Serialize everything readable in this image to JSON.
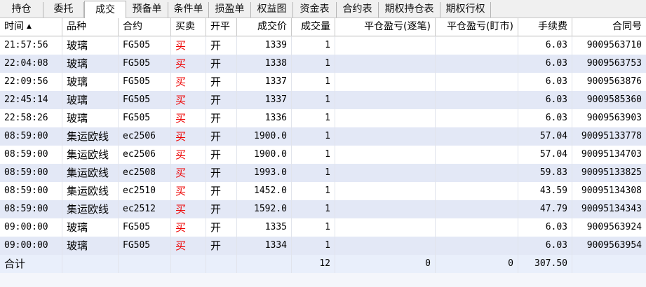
{
  "tabs": [
    {
      "label": "持仓",
      "active": false
    },
    {
      "label": "委托",
      "active": false
    },
    {
      "label": "成交",
      "active": true
    },
    {
      "label": "预备单",
      "active": false
    },
    {
      "label": "条件单",
      "active": false
    },
    {
      "label": "损盈单",
      "active": false
    },
    {
      "label": "权益图",
      "active": false
    },
    {
      "label": "资金表",
      "active": false
    },
    {
      "label": "合约表",
      "active": false
    },
    {
      "label": "期权持仓表",
      "active": false
    },
    {
      "label": "期权行权",
      "active": false
    }
  ],
  "table": {
    "columns": [
      "时间",
      "品种",
      "合约",
      "买卖",
      "开平",
      "成交价",
      "成交量",
      "平仓盈亏(逐笔)",
      "平仓盈亏(盯市)",
      "手续费",
      "合同号"
    ],
    "sort_icon": "sort-ascending-icon",
    "sort_glyph": "▲",
    "rows": [
      [
        "21:57:56",
        "玻璃",
        "FG505",
        "买",
        "开",
        "1339",
        "1",
        "",
        "",
        "6.03",
        "9009563710"
      ],
      [
        "22:04:08",
        "玻璃",
        "FG505",
        "买",
        "开",
        "1338",
        "1",
        "",
        "",
        "6.03",
        "9009563753"
      ],
      [
        "22:09:56",
        "玻璃",
        "FG505",
        "买",
        "开",
        "1337",
        "1",
        "",
        "",
        "6.03",
        "9009563876"
      ],
      [
        "22:45:14",
        "玻璃",
        "FG505",
        "买",
        "开",
        "1337",
        "1",
        "",
        "",
        "6.03",
        "9009585360"
      ],
      [
        "22:58:26",
        "玻璃",
        "FG505",
        "买",
        "开",
        "1336",
        "1",
        "",
        "",
        "6.03",
        "9009563903"
      ],
      [
        "08:59:00",
        "集运欧线",
        "ec2506",
        "买",
        "开",
        "1900.0",
        "1",
        "",
        "",
        "57.04",
        "90095133778"
      ],
      [
        "08:59:00",
        "集运欧线",
        "ec2506",
        "买",
        "开",
        "1900.0",
        "1",
        "",
        "",
        "57.04",
        "90095134703"
      ],
      [
        "08:59:00",
        "集运欧线",
        "ec2508",
        "买",
        "开",
        "1993.0",
        "1",
        "",
        "",
        "59.83",
        "90095133825"
      ],
      [
        "08:59:00",
        "集运欧线",
        "ec2510",
        "买",
        "开",
        "1452.0",
        "1",
        "",
        "",
        "43.59",
        "90095134308"
      ],
      [
        "08:59:00",
        "集运欧线",
        "ec2512",
        "买",
        "开",
        "1592.0",
        "1",
        "",
        "",
        "47.79",
        "90095134343"
      ],
      [
        "09:00:00",
        "玻璃",
        "FG505",
        "买",
        "开",
        "1335",
        "1",
        "",
        "",
        "6.03",
        "9009563924"
      ],
      [
        "09:00:00",
        "玻璃",
        "FG505",
        "买",
        "开",
        "1334",
        "1",
        "",
        "",
        "6.03",
        "9009563954"
      ]
    ],
    "totals": {
      "label": "合计",
      "volume": "12",
      "pnl_trade": "0",
      "pnl_mark": "0",
      "fee": "307.50"
    }
  },
  "colors": {
    "buy_text": "#ee0000",
    "row_alt": "#e3e8f6",
    "total_row": "#e9effb"
  }
}
